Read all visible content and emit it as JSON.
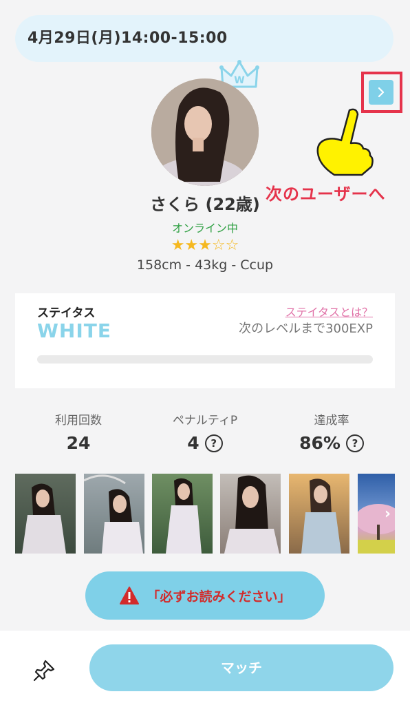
{
  "header": {
    "datetime": "4月29日(月)14:00-15:00"
  },
  "profile": {
    "crown_letter": "W",
    "name_age": "さくら (22歳)",
    "online_status": "オンライン中",
    "rating": 3.5,
    "rating_max": 5,
    "rating_stars": "★★★☆☆",
    "stats": "158cm - 43kg - Ccup"
  },
  "annotation": {
    "next_label": "次のユーザーへ",
    "next_icon": "chevron-right-icon",
    "highlight_color": "#e5334b",
    "hand_color": "#fff200"
  },
  "status": {
    "title": "ステイタス",
    "level": "WHITE",
    "help_link": "ステイタスとは？",
    "next_level_text": "次のレベルまで300EXP",
    "progress_fraction": 0
  },
  "metrics": [
    {
      "label": "利用回数",
      "value": "24",
      "has_help": false
    },
    {
      "label": "ペナルティP",
      "value": "4",
      "has_help": true
    },
    {
      "label": "達成率",
      "value": "86%",
      "has_help": true
    }
  ],
  "help_icon_glyph": "?",
  "gallery": {
    "count_visible": 6,
    "more_icon": "chevron-right-icon"
  },
  "notice": {
    "label": "「必ずお読みください」",
    "icon": "warning-icon"
  },
  "footer": {
    "pin_icon": "pin-icon",
    "match_label": "マッチ"
  },
  "colors": {
    "accent": "#7fd0e8",
    "online": "#2fa043",
    "star": "#f5b81f",
    "link": "#e173a8",
    "warning": "#d22b2b"
  }
}
